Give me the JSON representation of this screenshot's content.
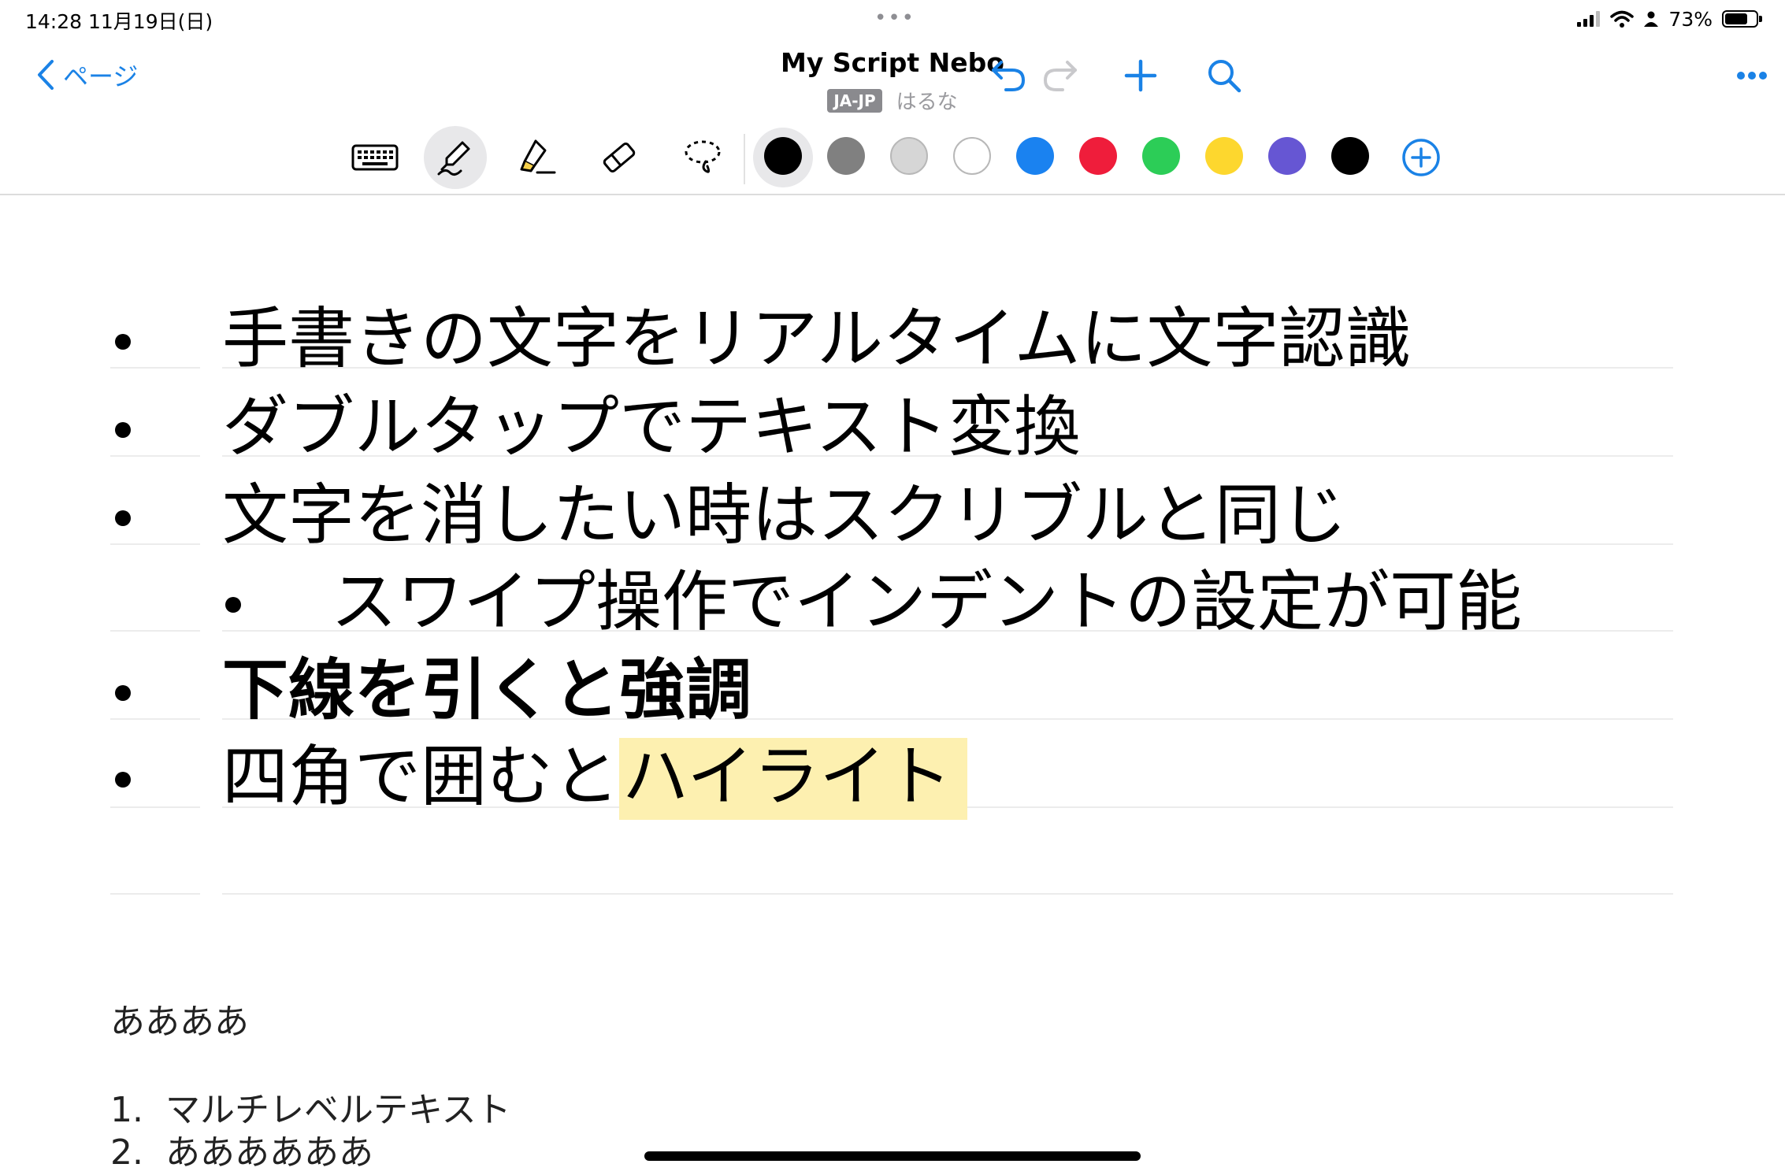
{
  "status_bar": {
    "time_date": "14:28  11月19日(日)",
    "dots": "•••",
    "battery_percent": "73%",
    "battery_level": 0.73,
    "icons": [
      "signal-icon",
      "wifi-icon",
      "person-icon",
      "battery-icon"
    ]
  },
  "nav": {
    "back_label": "ページ",
    "title": "My Script Nebo",
    "lang_badge": "JA-JP",
    "user_name": "はるな",
    "icons": [
      "undo-icon",
      "redo-icon",
      "plus-icon",
      "search-icon",
      "more-icon"
    ]
  },
  "toolbar": {
    "tools": [
      "keyboard-icon",
      "pen-icon",
      "highlighter-icon",
      "eraser-icon",
      "lasso-icon"
    ],
    "active_tool": "pen",
    "colors": [
      "#000000",
      "#808080",
      "#d6d6d6",
      "#ffffff",
      "#1a82f0",
      "#ef1d3b",
      "#2ccd57",
      "#fdd72e",
      "#6656d3",
      "#000000"
    ],
    "selected_color_index": 0,
    "add_color_icon": "add-circle-icon",
    "accent": "#1a82e6"
  },
  "content": {
    "bullets": [
      {
        "text": "手書きの文字をリアルタイムに文字認識",
        "level": 0
      },
      {
        "text": "ダブルタップでテキスト変換",
        "level": 0
      },
      {
        "text": "文字を消したい時はスクリブルと同じ",
        "level": 0
      },
      {
        "text": "スワイプ操作でインデントの設定が可能",
        "level": 1
      },
      {
        "text": "下線を引くと強調",
        "level": 0,
        "style": "bold"
      },
      {
        "text_plain": "四角で囲むと",
        "text_highlight": "ハイライト",
        "level": 0,
        "highlight_color": "#fdf0b0"
      }
    ],
    "paragraph": "ああああ",
    "numbered_list": [
      {
        "marker": "1.",
        "text": "マルチレベルテキスト"
      },
      {
        "marker": "2.",
        "text": "ああああああ"
      }
    ]
  }
}
